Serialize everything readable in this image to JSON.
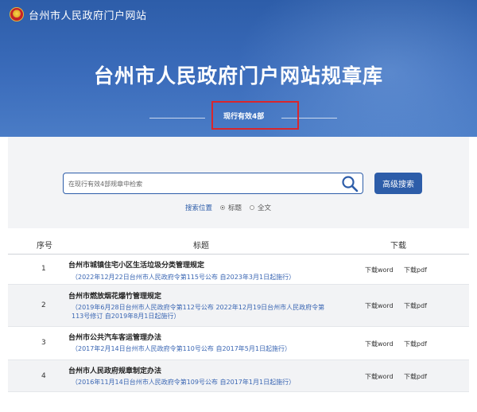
{
  "site": {
    "name": "台州市人民政府门户网站"
  },
  "hero": {
    "title": "台州市人民政府门户网站规章库",
    "count_text": "现行有效4部"
  },
  "search": {
    "placeholder": "在现行有效4部规章中检索",
    "advanced_label": "高级搜索",
    "scope_label": "搜索位置",
    "options": [
      "标题",
      "全文"
    ],
    "selected": "标题"
  },
  "table": {
    "headers": {
      "index": "序号",
      "title": "标题",
      "download": "下载"
    },
    "rows": [
      {
        "index": "1",
        "title": "台州市城镇住宅小区生活垃圾分类管理规定",
        "lines": [
          "（2022年12月22日台州市人民政府令第115号公布 自2023年3月1日起施行）"
        ],
        "word": "下载word",
        "pdf": "下载pdf"
      },
      {
        "index": "2",
        "title": "台州市燃放烟花爆竹管理规定",
        "lines": [
          "（2019年6月28日台州市人民政府令第112号公布 2022年12月19日台州市人民政府令第",
          "113号修订 自2019年8月1日起施行）"
        ],
        "word": "下载word",
        "pdf": "下载pdf"
      },
      {
        "index": "3",
        "title": "台州市公共汽车客运管理办法",
        "lines": [
          "（2017年2月14日台州市人民政府令第110号公布 自2017年5月1日起施行）"
        ],
        "word": "下载word",
        "pdf": "下载pdf"
      },
      {
        "index": "4",
        "title": "台州市人民政府规章制定办法",
        "lines": [
          "（2016年11月14日台州市人民政府令第109号公布 自2017年1月1日起施行）"
        ],
        "word": "下载word",
        "pdf": "下载pdf"
      }
    ]
  },
  "colors": {
    "brand_blue": "#2d5da9",
    "highlight_red": "#d9262c"
  }
}
